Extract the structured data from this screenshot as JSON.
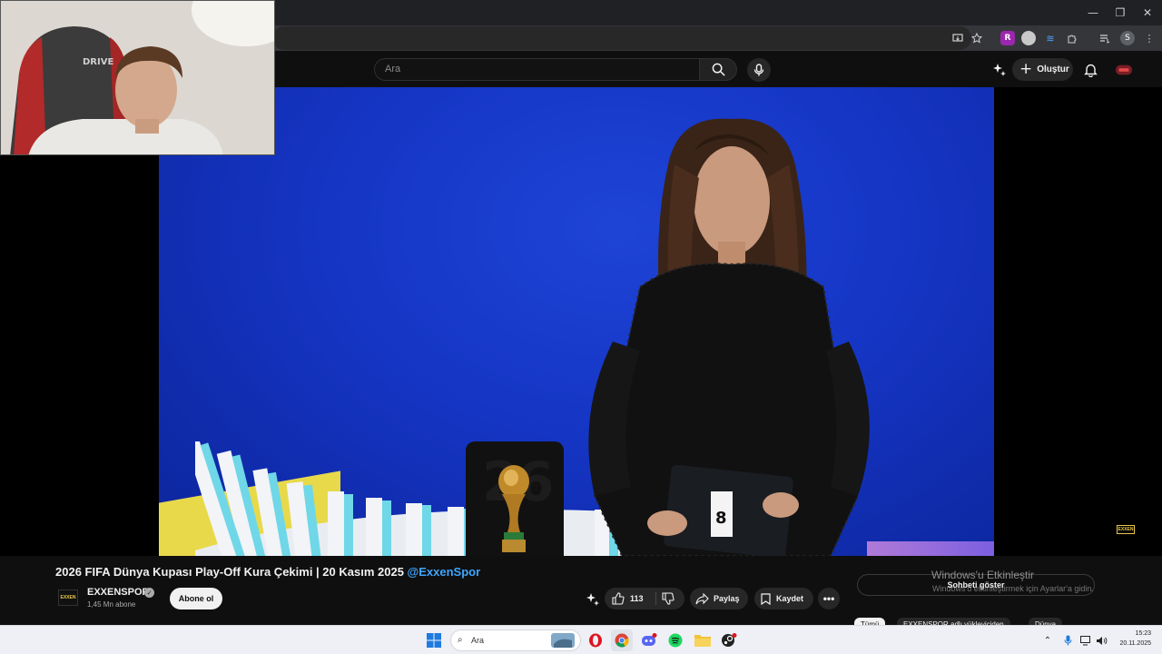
{
  "browser": {
    "window_controls": {
      "minimize": "—",
      "restore": "❐",
      "close": "✕"
    },
    "profile_initial": "S"
  },
  "masthead": {
    "search_placeholder": "Ara",
    "create_label": "Oluştur"
  },
  "video": {
    "title": "2026 FIFA Dünya Kupası Play-Off Kura Çekimi | 20 Kasım 2025",
    "title_handle": "@ExxenSpor",
    "overlay_logo": "EXXEN",
    "channel_logo_text": "EXXEN",
    "webcam_chair_text": "DRIVE",
    "trophy_panel_text": "26"
  },
  "channel": {
    "name": "EXXENSPOR",
    "subscribers": "1,45 Mn abone",
    "subscribe_label": "Abone ol"
  },
  "actions": {
    "like_count": "113",
    "share_label": "Paylaş",
    "save_label": "Kaydet",
    "more_label": "•••"
  },
  "chat": {
    "show_chat_label": "Sohbeti göster"
  },
  "windows_activation": {
    "line1": "Windows'u Etkinleştir",
    "line2": "Windows'u etkinleştirmek için Ayarlar'a gidin."
  },
  "chips": [
    {
      "label": "Tümü",
      "active": true
    },
    {
      "label": "EXXENSPOR adlı yükleyiciden",
      "active": false
    },
    {
      "label": "Dünya",
      "active": false
    }
  ],
  "taskbar": {
    "search_placeholder": "Ara",
    "time": "15:23",
    "date": "20.11.2025"
  }
}
